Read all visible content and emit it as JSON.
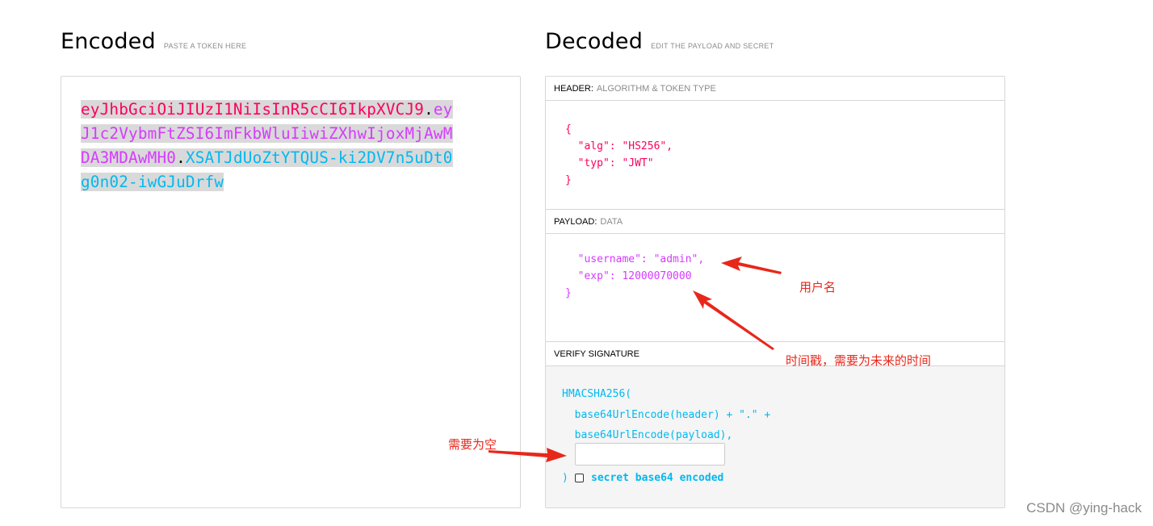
{
  "encoded": {
    "title": "Encoded",
    "subtitle": "PASTE A TOKEN HERE",
    "token_header": "eyJhbGciOiJIUzI1NiIsInR5cCI6IkpXVCJ9",
    "token_payload": "eyJ1c2VybmFtZSI6ImFkbWluIiwiZXhwIjoxMjAwMDA3MDAwMH0",
    "token_signature": "XSATJdUoZtYTQUS-ki2DV7n5uDt0g0n02-iwGJuDrfw",
    "dot": "."
  },
  "decoded": {
    "title": "Decoded",
    "subtitle": "EDIT THE PAYLOAD AND SECRET",
    "header": {
      "label": "HEADER:",
      "sublabel": "ALGORITHM & TOKEN TYPE",
      "lines": [
        "{",
        "  \"alg\": \"HS256\",",
        "  \"typ\": \"JWT\"",
        "}"
      ]
    },
    "payload": {
      "label": "PAYLOAD:",
      "sublabel": "DATA",
      "lines": [
        "  \"username\": \"admin\",",
        "  \"exp\": 12000070000",
        "}"
      ]
    },
    "signature": {
      "label": "VERIFY SIGNATURE",
      "lines": [
        "HMACSHA256(",
        "  base64UrlEncode(header) + \".\" +",
        "  base64UrlEncode(payload),"
      ],
      "close": ")",
      "secret_value": "",
      "checkbox_label": "secret base64 encoded",
      "checkbox_checked": false
    }
  },
  "annotations": {
    "username": "用户名",
    "timestamp": "时间戳，需要为未来的时间",
    "empty": "需要为空"
  },
  "watermark": "CSDN @ying-hack",
  "colors": {
    "header": "#fb015b",
    "payload": "#d63aff",
    "signature": "#00b9f1",
    "annotation": "#e8271b"
  }
}
